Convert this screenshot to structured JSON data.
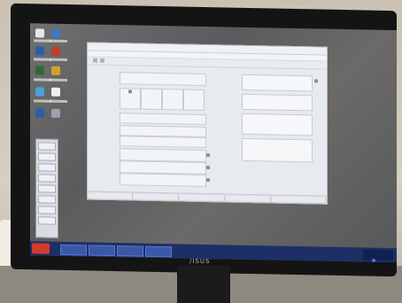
{
  "monitor": {
    "brand": "/ISUS"
  },
  "desktop": {
    "icon_count": 10
  },
  "taskbar": {
    "start_label": "",
    "tray_clock": ""
  },
  "app": {
    "title": "",
    "menu": "",
    "left_labels": [
      "",
      "",
      "",
      "",
      "",
      "",
      "",
      ""
    ],
    "right_labels": [
      "",
      "",
      "",
      ""
    ]
  }
}
